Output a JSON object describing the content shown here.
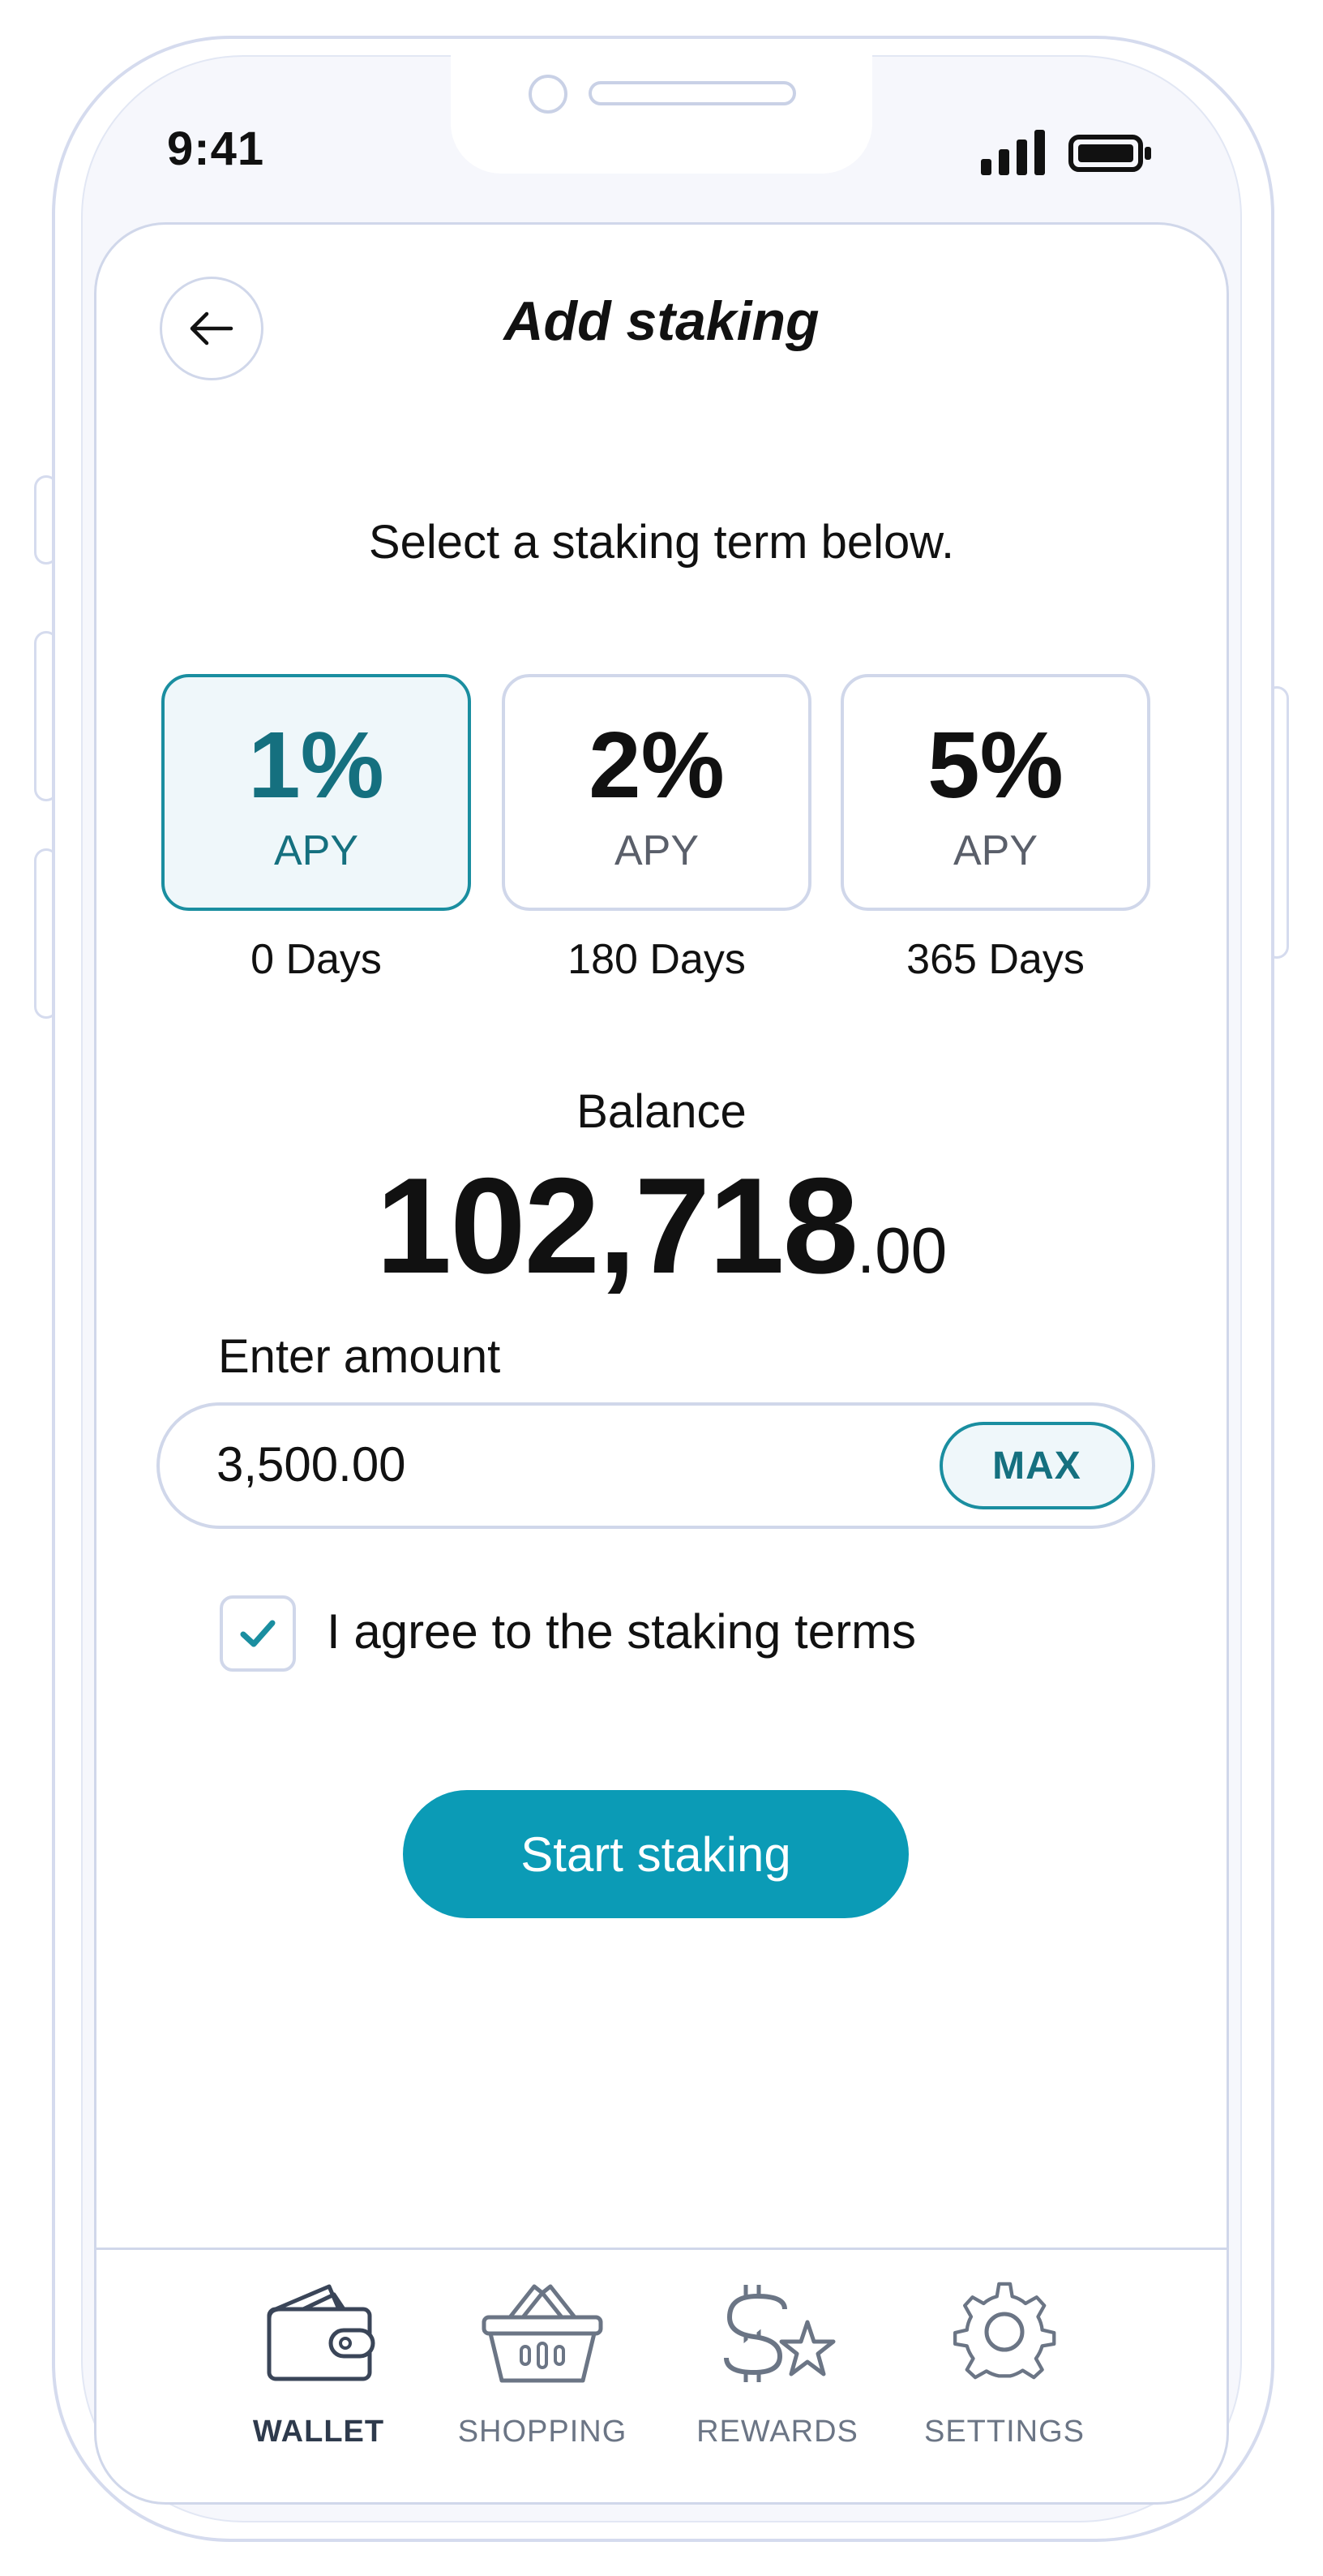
{
  "status_bar": {
    "time": "9:41"
  },
  "header": {
    "title": "Add staking",
    "back_icon": "arrow-left-icon"
  },
  "instruction": "Select a staking term below.",
  "terms": [
    {
      "rate": "1%",
      "unit": "APY",
      "days": "0 Days",
      "selected": true
    },
    {
      "rate": "2%",
      "unit": "APY",
      "days": "180 Days",
      "selected": false
    },
    {
      "rate": "5%",
      "unit": "APY",
      "days": "365 Days",
      "selected": false
    }
  ],
  "balance": {
    "label": "Balance",
    "integer": "102,718",
    "decimal": ".00"
  },
  "amount": {
    "label": "Enter amount",
    "value": "3,500.00",
    "max_label": "MAX"
  },
  "agreement": {
    "label": "I agree to the staking terms",
    "checked": true
  },
  "cta": {
    "label": "Start staking"
  },
  "tabs": [
    {
      "label": "WALLET",
      "icon": "wallet-icon",
      "active": true
    },
    {
      "label": "SHOPPING",
      "icon": "shopping-basket-icon",
      "active": false
    },
    {
      "label": "REWARDS",
      "icon": "dollar-star-icon",
      "active": false
    },
    {
      "label": "SETTINGS",
      "icon": "gear-icon",
      "active": false
    }
  ],
  "colors": {
    "accent": "#0b9bb6",
    "accent_dark": "#15707f",
    "selected_bg": "#eff7fa",
    "border": "#d0d7ea",
    "text": "#111111",
    "muted": "#6b7585"
  }
}
